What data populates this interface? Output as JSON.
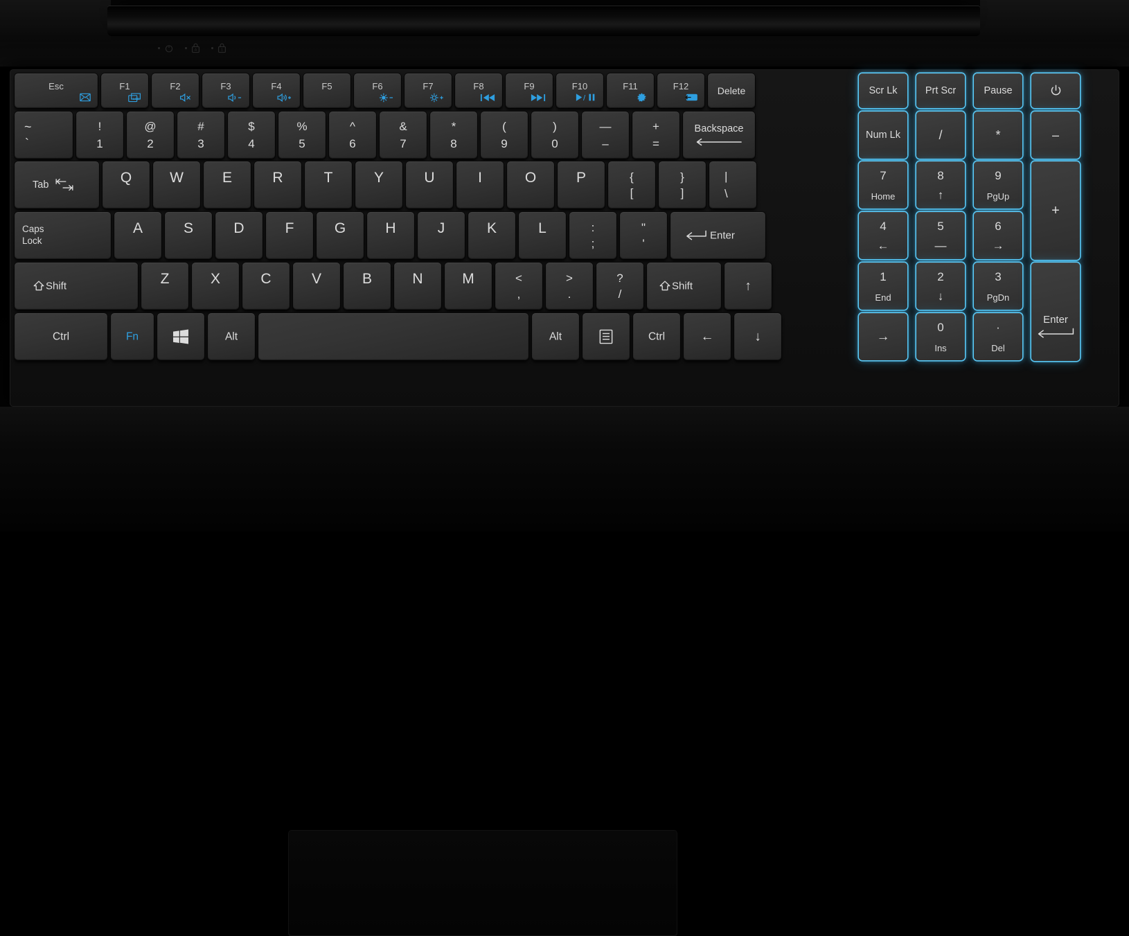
{
  "device": {
    "type": "laptop-keyboard",
    "colors": {
      "backlight": "#2e9fe0",
      "key_face": "#343434",
      "legend": "#dcdcdc",
      "chassis": "#0d0d0d"
    }
  },
  "indicators": [
    {
      "name": "power-indicator",
      "icon": "power-icon"
    },
    {
      "name": "caps-lock-indicator",
      "icon": "caps-lock-icon"
    },
    {
      "name": "num-lock-indicator",
      "icon": "num-lock-icon"
    }
  ],
  "rows": {
    "function_row": [
      {
        "id": "esc",
        "top": "Esc",
        "icon": "mail-icon"
      },
      {
        "id": "f1",
        "top": "F1",
        "icon": "lcd-display-icon"
      },
      {
        "id": "f2",
        "top": "F2",
        "icon": "volume-mute-icon"
      },
      {
        "id": "f3",
        "top": "F3",
        "icon": "volume-down-icon"
      },
      {
        "id": "f4",
        "top": "F4",
        "icon": "volume-up-icon"
      },
      {
        "id": "f5",
        "top": "F5",
        "icon": ""
      },
      {
        "id": "f6",
        "top": "F6",
        "icon": "brightness-down-icon"
      },
      {
        "id": "f7",
        "top": "F7",
        "icon": "brightness-up-icon"
      },
      {
        "id": "f8",
        "top": "F8",
        "icon": "previous-track-icon"
      },
      {
        "id": "f9",
        "top": "F9",
        "icon": "next-track-icon"
      },
      {
        "id": "f10",
        "top": "F10",
        "icon": "play-pause-icon"
      },
      {
        "id": "f11",
        "top": "F11",
        "icon": "settings-gear-icon"
      },
      {
        "id": "f12",
        "top": "F12",
        "icon": "display-output-icon"
      },
      {
        "id": "delete",
        "top": "Delete",
        "icon": ""
      }
    ],
    "function_row_right": [
      {
        "id": "scrlk",
        "label": "Scr Lk",
        "lit": true
      },
      {
        "id": "prtscr",
        "label": "Prt Scr",
        "lit": true
      },
      {
        "id": "pause",
        "label": "Pause",
        "lit": true
      },
      {
        "id": "power",
        "label": "",
        "icon": "power-icon",
        "lit": true
      }
    ],
    "number_row": [
      {
        "id": "backtick",
        "upper": "~",
        "lower": "`"
      },
      {
        "id": "1",
        "upper": "!",
        "lower": "1"
      },
      {
        "id": "2",
        "upper": "@",
        "lower": "2"
      },
      {
        "id": "3",
        "upper": "#",
        "lower": "3"
      },
      {
        "id": "4",
        "upper": "$",
        "lower": "4"
      },
      {
        "id": "5",
        "upper": "%",
        "lower": "5"
      },
      {
        "id": "6",
        "upper": "^",
        "lower": "6"
      },
      {
        "id": "7",
        "upper": "&",
        "lower": "7"
      },
      {
        "id": "8",
        "upper": "*",
        "lower": "8"
      },
      {
        "id": "9",
        "upper": "(",
        "lower": "9"
      },
      {
        "id": "0",
        "upper": ")",
        "lower": "0"
      },
      {
        "id": "minus",
        "upper": "—",
        "lower": "–"
      },
      {
        "id": "equals",
        "upper": "+",
        "lower": "="
      },
      {
        "id": "backspace",
        "label": "Backspace",
        "icon": "arrow-left-long-icon"
      }
    ],
    "number_row_right": [
      {
        "id": "numlk",
        "label": "Num Lk",
        "lit": true
      },
      {
        "id": "npdiv",
        "label": "/",
        "lit": true
      },
      {
        "id": "npmul",
        "label": "*",
        "lit": true
      },
      {
        "id": "npsub",
        "label": "–",
        "lit": true
      }
    ],
    "qwerty_row": [
      {
        "id": "tab",
        "label": "Tab",
        "icon": "tab-icon"
      },
      {
        "id": "q",
        "label": "Q"
      },
      {
        "id": "w",
        "label": "W"
      },
      {
        "id": "e",
        "label": "E"
      },
      {
        "id": "r",
        "label": "R"
      },
      {
        "id": "t",
        "label": "T"
      },
      {
        "id": "y",
        "label": "Y"
      },
      {
        "id": "u",
        "label": "U"
      },
      {
        "id": "i",
        "label": "I"
      },
      {
        "id": "o",
        "label": "O"
      },
      {
        "id": "p",
        "label": "P"
      },
      {
        "id": "lbracket",
        "upper": "{",
        "lower": "["
      },
      {
        "id": "rbracket",
        "upper": "}",
        "lower": "]"
      },
      {
        "id": "backslash",
        "upper": "|",
        "lower": "\\"
      }
    ],
    "qwerty_row_right": [
      {
        "id": "np7",
        "top": "7",
        "bottom": "Home",
        "lit": true
      },
      {
        "id": "np8",
        "top": "8",
        "bottom": "↑",
        "lit": true
      },
      {
        "id": "np9",
        "top": "9",
        "bottom": "PgUp",
        "lit": true
      },
      {
        "id": "npadd",
        "label": "+",
        "lit": true
      }
    ],
    "home_row": [
      {
        "id": "capslock",
        "line1": "Caps",
        "line2": "Lock"
      },
      {
        "id": "a",
        "label": "A"
      },
      {
        "id": "s",
        "label": "S"
      },
      {
        "id": "d",
        "label": "D"
      },
      {
        "id": "f",
        "label": "F"
      },
      {
        "id": "g",
        "label": "G"
      },
      {
        "id": "h",
        "label": "H"
      },
      {
        "id": "j",
        "label": "J"
      },
      {
        "id": "k",
        "label": "K"
      },
      {
        "id": "l",
        "label": "L"
      },
      {
        "id": "semicolon",
        "upper": ":",
        "lower": ";"
      },
      {
        "id": "quote",
        "upper": "\"",
        "lower": "'"
      },
      {
        "id": "enter",
        "label": "Enter",
        "icon": "enter-arrow-icon"
      }
    ],
    "home_row_right": [
      {
        "id": "np4",
        "top": "4",
        "bottom": "←",
        "lit": true
      },
      {
        "id": "np5",
        "top": "5",
        "bottom": "—",
        "lit": true
      },
      {
        "id": "np6",
        "top": "6",
        "bottom": "→",
        "lit": true
      }
    ],
    "shift_row": [
      {
        "id": "lshift",
        "label": "Shift",
        "icon": "shift-arrow-icon"
      },
      {
        "id": "z",
        "label": "Z"
      },
      {
        "id": "x",
        "label": "X"
      },
      {
        "id": "c",
        "label": "C"
      },
      {
        "id": "v",
        "label": "V"
      },
      {
        "id": "b",
        "label": "B"
      },
      {
        "id": "n",
        "label": "N"
      },
      {
        "id": "m",
        "label": "M"
      },
      {
        "id": "comma",
        "upper": "<",
        "lower": ","
      },
      {
        "id": "period",
        "upper": ">",
        "lower": "."
      },
      {
        "id": "slash",
        "upper": "?",
        "lower": "/"
      },
      {
        "id": "rshift",
        "label": "Shift",
        "icon": "shift-arrow-icon"
      },
      {
        "id": "arrowup",
        "label": "↑"
      }
    ],
    "shift_row_right": [
      {
        "id": "np1",
        "top": "1",
        "bottom": "End",
        "lit": true
      },
      {
        "id": "np2",
        "top": "2",
        "bottom": "↓",
        "lit": true
      },
      {
        "id": "np3",
        "top": "3",
        "bottom": "PgDn",
        "lit": true
      },
      {
        "id": "npenter",
        "label": "Enter",
        "icon": "enter-arrow-icon",
        "lit": true
      }
    ],
    "bottom_row": [
      {
        "id": "lctrl",
        "label": "Ctrl"
      },
      {
        "id": "fn",
        "label": "Fn",
        "cyan": true
      },
      {
        "id": "win",
        "label": "",
        "icon": "windows-icon"
      },
      {
        "id": "lalt",
        "label": "Alt"
      },
      {
        "id": "space",
        "label": ""
      },
      {
        "id": "ralt",
        "label": "Alt"
      },
      {
        "id": "menu",
        "label": "",
        "icon": "context-menu-icon"
      },
      {
        "id": "rctrl",
        "label": "Ctrl"
      },
      {
        "id": "arrowleft",
        "label": "←"
      },
      {
        "id": "arrowdown",
        "label": "↓"
      }
    ],
    "bottom_row_right": [
      {
        "id": "nparrowright",
        "label": "→",
        "lit": true
      },
      {
        "id": "np0",
        "top": "0",
        "bottom": "Ins",
        "lit": true
      },
      {
        "id": "npdot",
        "top": "·",
        "bottom": "Del",
        "lit": true
      }
    ]
  }
}
